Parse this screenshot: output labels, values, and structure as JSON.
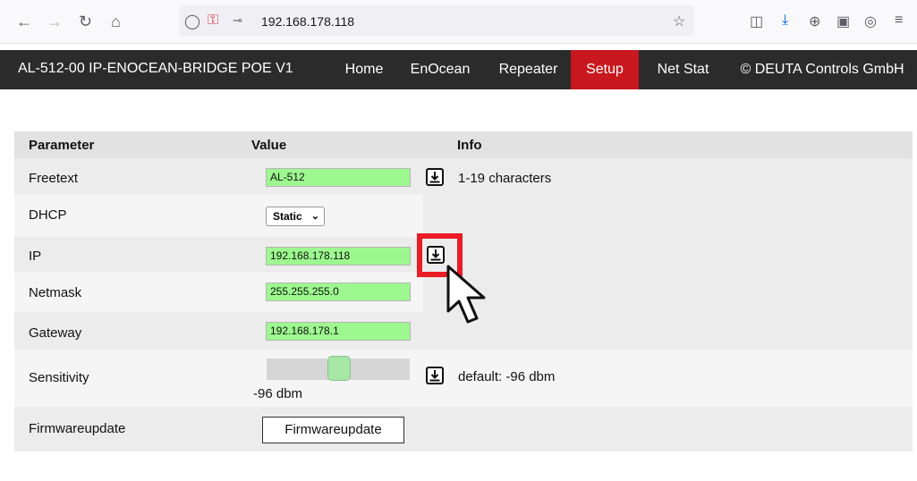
{
  "browser": {
    "url": "192.168.178.118"
  },
  "nav": {
    "brand": "AL-512-00 IP-ENOCEAN-BRIDGE POE V1",
    "items": [
      {
        "label": "Home"
      },
      {
        "label": "EnOcean"
      },
      {
        "label": "Repeater"
      },
      {
        "label": "Setup",
        "active": true
      },
      {
        "label": "Net Stat"
      },
      {
        "label": "© DEUTA Controls GmbH"
      }
    ],
    "active_color": "#c8171e"
  },
  "table": {
    "headers": {
      "param": "Parameter",
      "value": "Value",
      "info": "Info"
    },
    "rows": {
      "freetext": {
        "label": "Freetext",
        "value": "AL-512",
        "info": "1-19 characters"
      },
      "dhcp": {
        "label": "DHCP",
        "selected": "Static"
      },
      "ip": {
        "label": "IP",
        "value": "192.168.178.118"
      },
      "netmask": {
        "label": "Netmask",
        "value": "255.255.255.0"
      },
      "gateway": {
        "label": "Gateway",
        "value": "192.168.178.1"
      },
      "sensitivity": {
        "label": "Sensitivity",
        "value_text": "-96 dbm",
        "info": "default: -96 dbm"
      },
      "firmware": {
        "label": "Firmwareupdate",
        "button": "Firmwareupdate"
      }
    }
  },
  "colors": {
    "input_bg": "#9df98f",
    "highlight": "#ea1c25"
  }
}
